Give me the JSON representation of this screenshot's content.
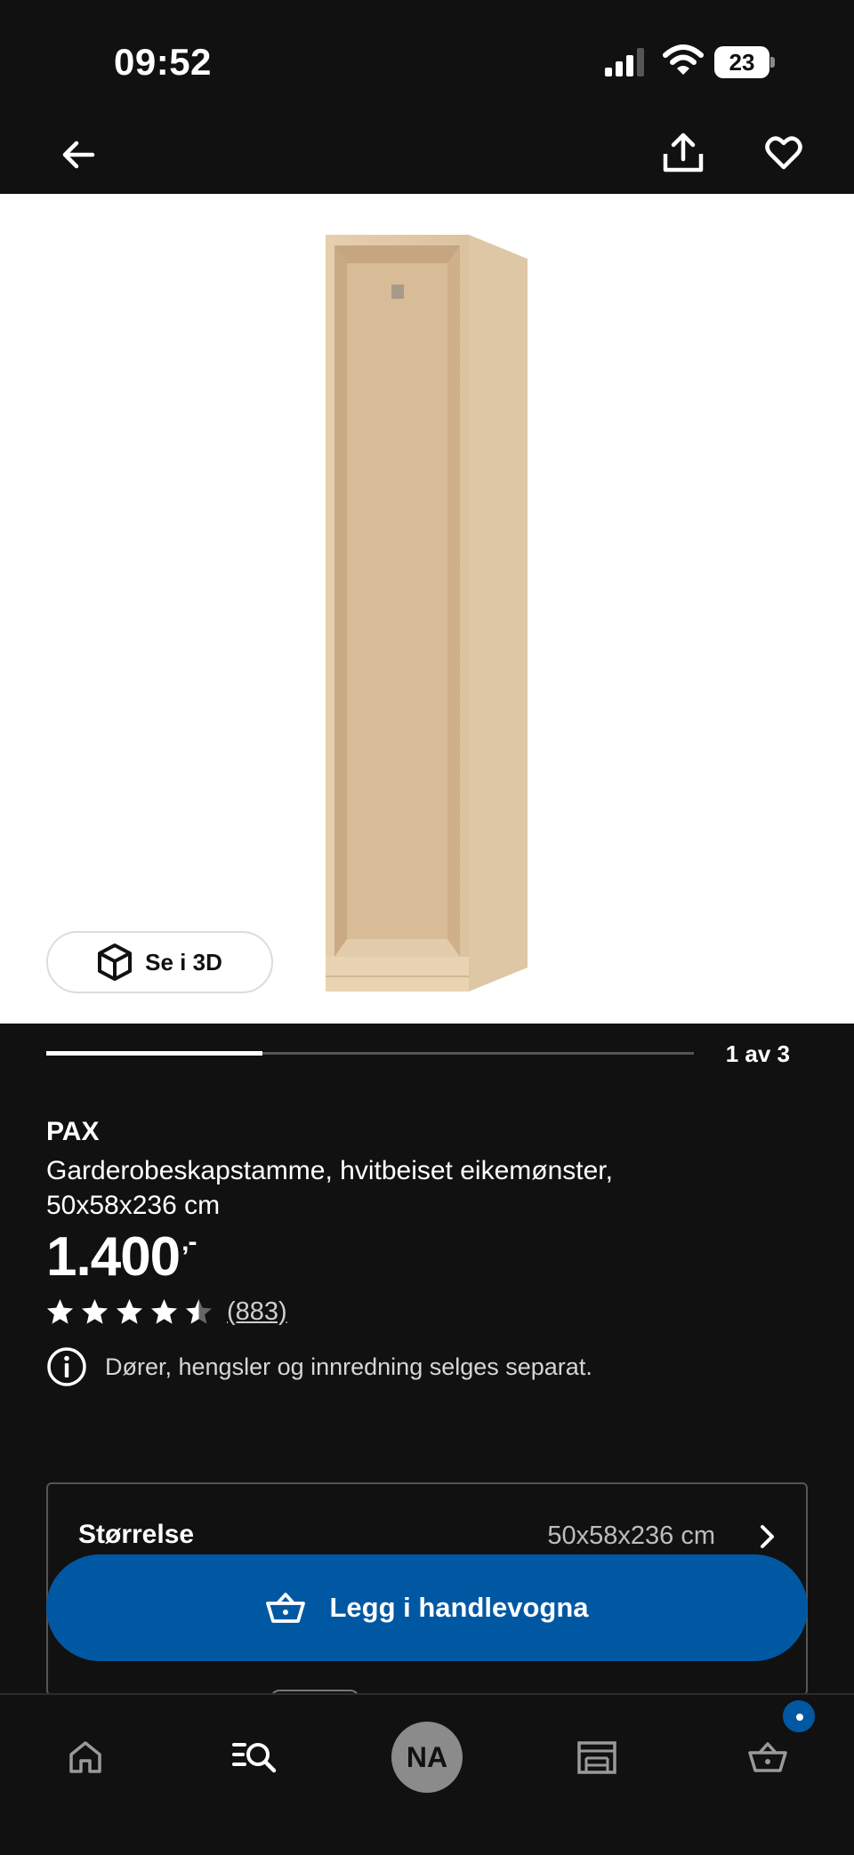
{
  "status_bar": {
    "time": "09:52",
    "battery": "23"
  },
  "nav": {
    "back_icon": "arrow-left-icon",
    "share_icon": "share-icon",
    "favorite_icon": "heart-icon"
  },
  "gallery": {
    "view_3d_label": "Se i 3D",
    "counter": "1 av 3",
    "current": 1,
    "total": 3
  },
  "product": {
    "name": "PAX",
    "description": "Garderobeskapstamme, hvitbeiset eikemønster, 50x58x236 cm",
    "price": "1.400",
    "price_suffix": ",-",
    "rating": 4.5,
    "review_count": "(883)",
    "info_text": "Dører, hengsler og innredning selges separat."
  },
  "options": {
    "size_label": "Størrelse",
    "size_value": "50x58x236 cm"
  },
  "cart_button": {
    "label": "Legg i handlevogna"
  },
  "tab_bar": {
    "avatar_initials": "NA",
    "tabs": [
      "home-icon",
      "search-list-icon",
      "profile-avatar",
      "store-icon",
      "basket-icon"
    ]
  },
  "colors": {
    "background": "#111111",
    "accent_blue": "#0058a3",
    "white": "#ffffff"
  }
}
